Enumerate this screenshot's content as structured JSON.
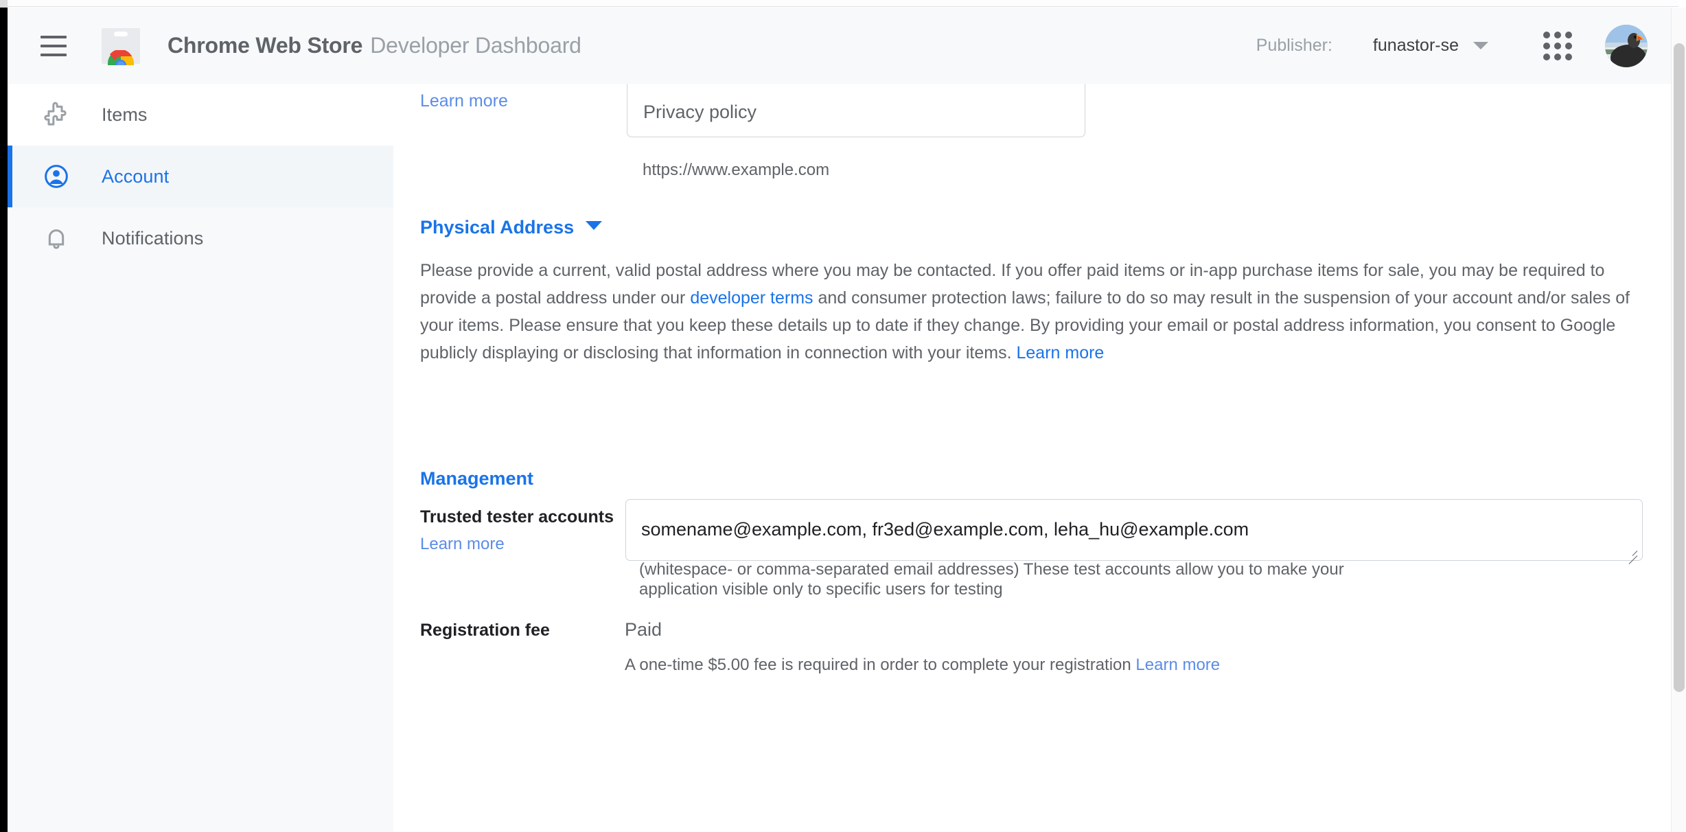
{
  "window": {
    "scrollbar_name": "vertical-scrollbar"
  },
  "header": {
    "menu_icon": "hamburger-menu-icon",
    "logo_icon": "chrome-web-store-logo",
    "title_strong": "Chrome Web Store",
    "title_light": "Developer Dashboard",
    "publisher_label": "Publisher:",
    "publisher_value": "funastor-se",
    "publisher_caret_icon": "chevron-down-icon",
    "apps_icon": "google-apps-grid-icon",
    "avatar_icon": "user-avatar"
  },
  "sidebar": {
    "items": [
      {
        "label": "Items",
        "icon": "puzzle-piece-icon",
        "active": false
      },
      {
        "label": "Account",
        "icon": "account-circle-icon",
        "active": true
      },
      {
        "label": "Notifications",
        "icon": "bell-icon",
        "active": false
      }
    ]
  },
  "main": {
    "privacy": {
      "learn_more": "Learn more",
      "field_value": "Privacy policy",
      "helper_text": "https://www.example.com"
    },
    "physical_address": {
      "heading": "Physical Address",
      "paragraph_part1": "Please provide a current, valid postal address where you may be contacted. If you offer paid items or in-app purchase items for sale, you may be required to provide a postal address under our ",
      "paragraph_link1": "developer terms",
      "paragraph_part2": " and consumer protection laws; failure to do so may result in the suspension of your account and/or sales of your items. Please ensure that you keep these details up to date if they change. By providing your email or postal address information, you consent to Google publicly displaying or disclosing that information in connection with your items. ",
      "paragraph_link2": "Learn more"
    },
    "management": {
      "heading": "Management",
      "trusted_tester": {
        "label": "Trusted tester accounts",
        "learn_more": "Learn more",
        "value": "somename@example.com, fr3ed@example.com, leha_hu@example.com",
        "placeholder": "",
        "helper_text": "(whitespace- or comma-separated email addresses) These test accounts allow you to make your application visible only to specific users for testing"
      },
      "registration_fee": {
        "label": "Registration fee",
        "value": "Paid",
        "note_part1": "A one-time $5.00 fee is required in order to complete your registration ",
        "note_link": "Learn more"
      }
    }
  },
  "colors": {
    "accent_blue": "#1a73e8",
    "link_blue": "#5c8ce6",
    "text_gray": "#5f6368",
    "text_dark": "#202124",
    "sidebar_bg": "#f7f9fa"
  }
}
